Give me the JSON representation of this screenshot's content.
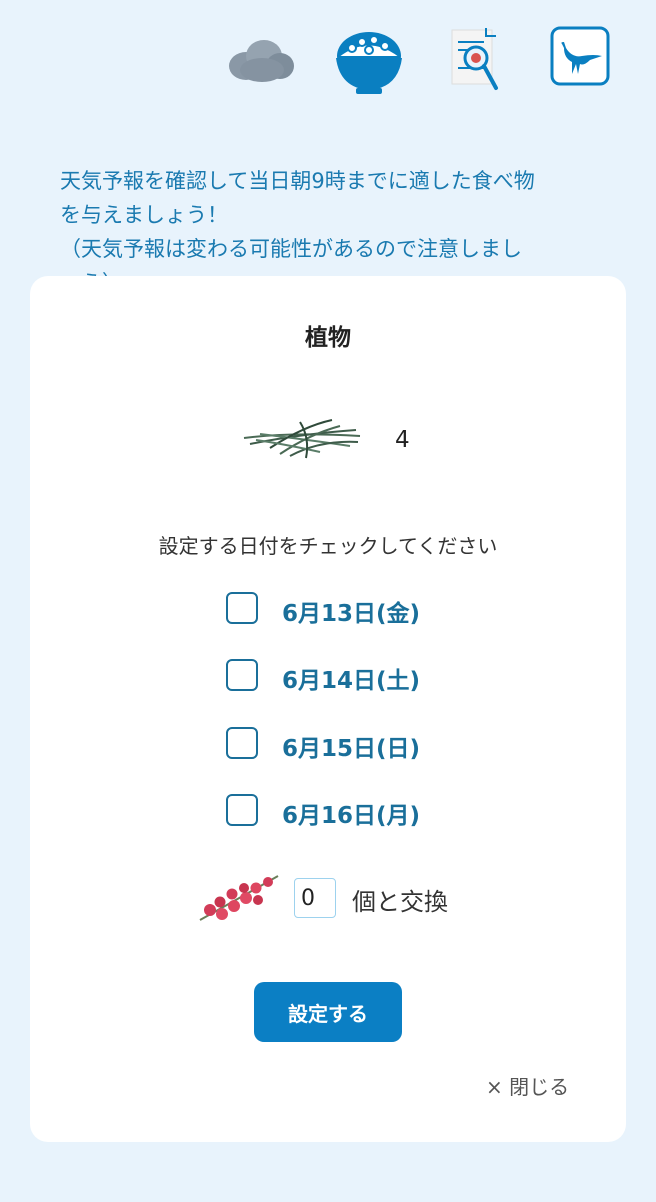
{
  "top_icons": [
    {
      "name": "cloud-icon",
      "kind": "weather"
    },
    {
      "name": "rice-bowl-icon",
      "kind": "food"
    },
    {
      "name": "document-search-icon",
      "kind": "search"
    },
    {
      "name": "dinosaur-icon",
      "kind": "dinosaur"
    }
  ],
  "notice_text": "天気予報を確認して当日朝9時までに適した食べ物\nを与えましょう！\n（天気予報は変わる可能性があるので注意しまし\nょう）",
  "modal": {
    "title": "植物",
    "item": {
      "icon": "grass-icon",
      "quantity": "4"
    },
    "instruction": "設定する日付をチェックしてください",
    "dates": [
      {
        "label": "6月13日(金)",
        "checked": false
      },
      {
        "label": "6月14日(土)",
        "checked": false
      },
      {
        "label": "6月15日(日)",
        "checked": false
      },
      {
        "label": "6月16日(月)",
        "checked": false
      }
    ],
    "exchange": {
      "icon": "berries-icon",
      "value": "0",
      "suffix": "個と交換"
    },
    "set_button": "設定する",
    "close_label": "× 閉じる"
  },
  "colors": {
    "background": "#e8f3fc",
    "accent": "#0b7fc4",
    "date_text": "#1a6f9a",
    "notice_text": "#1a7ab0"
  }
}
